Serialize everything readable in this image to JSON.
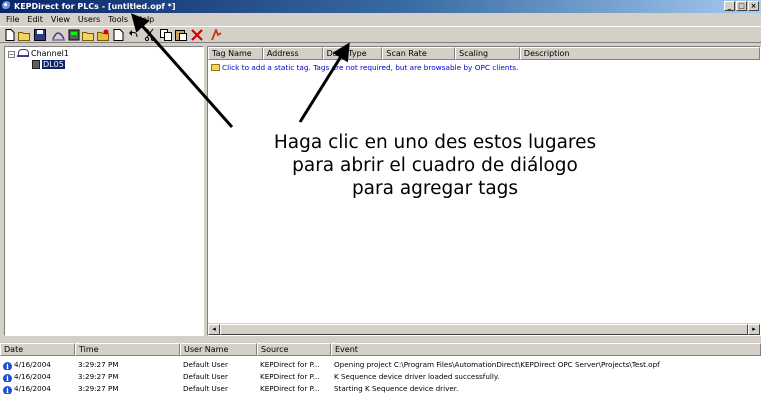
{
  "window": {
    "title": "KEPDirect for PLCs - [untitled.opf *]",
    "controls": [
      "_",
      "□",
      "×"
    ]
  },
  "menu": [
    "File",
    "Edit",
    "View",
    "Users",
    "Tools",
    "Help"
  ],
  "tree": {
    "channel": "Channel1",
    "device": "DL05"
  },
  "tag_table": {
    "columns": [
      "Tag Name",
      "Address",
      "Data Type",
      "Scan Rate",
      "Scaling",
      "Description"
    ],
    "hint": "Click to add a static tag.  Tags are not required, but are browsable by OPC clients."
  },
  "annotation": {
    "line1": "Haga clic en uno des estos lugares",
    "line2": "para abrir el cuadro de diálogo",
    "line3": "para agregar tags"
  },
  "log": {
    "columns": [
      "Date",
      "Time",
      "User Name",
      "Source",
      "Event"
    ],
    "rows": [
      {
        "date": "4/16/2004",
        "time": "3:29:27 PM",
        "user": "Default User",
        "source": "KEPDirect for P...",
        "event": "Opening project C:\\Program Files\\AutomationDirect\\KEPDirect OPC Server\\Projects\\Test.opf"
      },
      {
        "date": "4/16/2004",
        "time": "3:29:27 PM",
        "user": "Default User",
        "source": "KEPDirect for P...",
        "event": "K Sequence device driver loaded successfully."
      },
      {
        "date": "4/16/2004",
        "time": "3:29:27 PM",
        "user": "Default User",
        "source": "KEPDirect for P...",
        "event": "Starting K Sequence device driver."
      }
    ]
  },
  "colors": {
    "title_bar": "#0a246a",
    "hint_text": "#0000c8",
    "info_icon": "#1f4fd0"
  }
}
